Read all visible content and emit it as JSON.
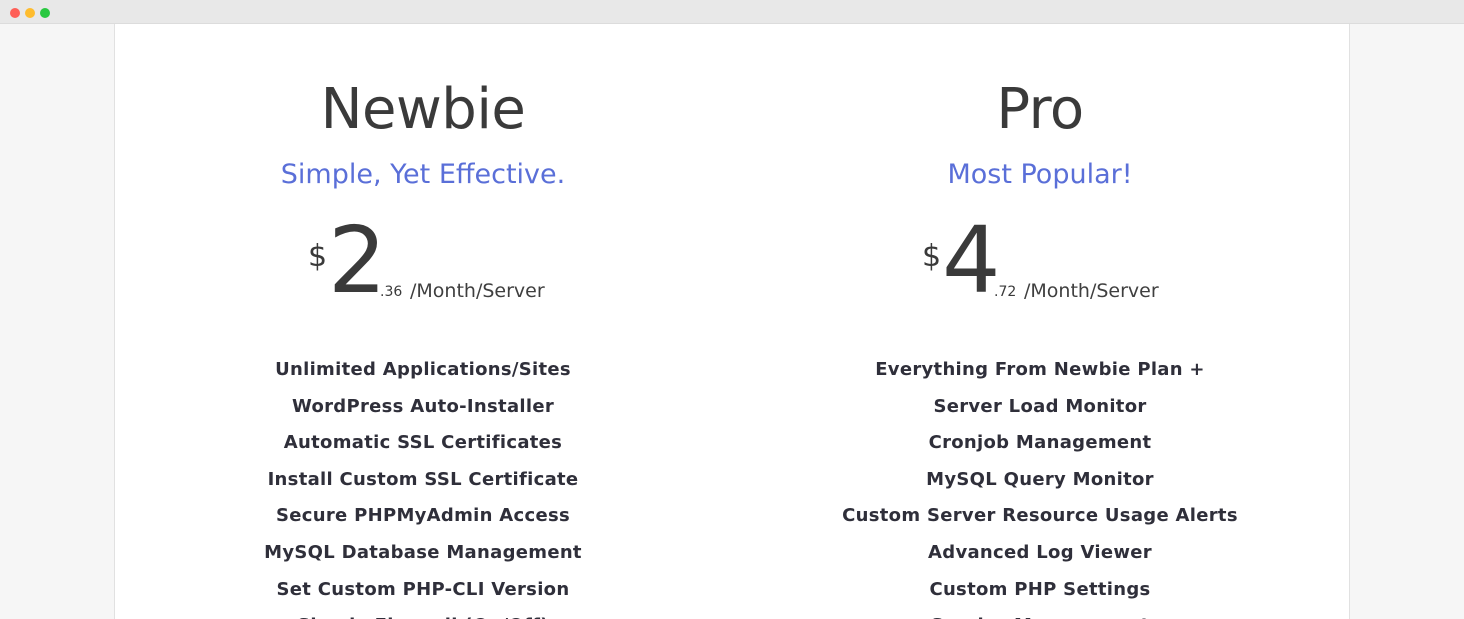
{
  "window": {
    "controls": [
      "close",
      "minimize",
      "maximize"
    ]
  },
  "colors": {
    "accent": "#5a6fd8",
    "heading": "#3a3a3a",
    "feature_text": "#2f2f3a"
  },
  "plans": [
    {
      "name": "Newbie",
      "tagline": "Simple, Yet Effective.",
      "currency": "$",
      "amount": "2",
      "cents": ".36",
      "period": "/Month/Server",
      "features": [
        "Unlimited Applications/Sites",
        "WordPress Auto-Installer",
        "Automatic SSL Certificates",
        "Install Custom SSL Certificate",
        "Secure PHPMyAdmin Access",
        "MySQL Database Management",
        "Set Custom PHP-CLI Version",
        "Simple Firewall (On/Off)"
      ]
    },
    {
      "name": "Pro",
      "tagline": "Most Popular!",
      "currency": "$",
      "amount": "4",
      "cents": ".72",
      "period": "/Month/Server",
      "features": [
        "Everything From Newbie Plan +",
        "Server Load Monitor",
        "Cronjob Management",
        "MySQL Query Monitor",
        "Custom Server Resource Usage Alerts",
        "Advanced Log Viewer",
        "Custom PHP Settings",
        "Service Management"
      ]
    }
  ]
}
